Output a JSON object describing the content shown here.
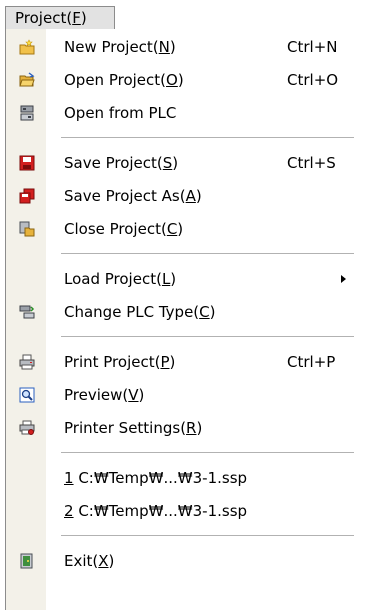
{
  "menu_title": {
    "pre": "Project(",
    "key": "F",
    "post": ")"
  },
  "items": [
    {
      "pre": "New Project(",
      "key": "N",
      "post": ")",
      "shortcut": "Ctrl+N",
      "icon": "new-project-icon"
    },
    {
      "pre": "Open Project(",
      "key": "O",
      "post": ")",
      "shortcut": "Ctrl+O",
      "icon": "open-project-icon"
    },
    {
      "pre": "Open from PLC",
      "key": "",
      "post": "",
      "shortcut": "",
      "icon": "open-from-plc-icon"
    },
    {
      "pre": "Save Project(",
      "key": "S",
      "post": ")",
      "shortcut": "Ctrl+S",
      "icon": "save-project-icon"
    },
    {
      "pre": "Save Project As(",
      "key": "A",
      "post": ")",
      "shortcut": "",
      "icon": "save-project-as-icon"
    },
    {
      "pre": "Close Project(",
      "key": "C",
      "post": ")",
      "shortcut": "",
      "icon": "close-project-icon"
    },
    {
      "pre": "Load Project(",
      "key": "L",
      "post": ")",
      "shortcut": "",
      "icon": "",
      "submenu": true
    },
    {
      "pre": "Change PLC Type(",
      "key": "C",
      "post": ")",
      "shortcut": "",
      "icon": "change-plc-type-icon"
    },
    {
      "pre": "Print Project(",
      "key": "P",
      "post": ")",
      "shortcut": "Ctrl+P",
      "icon": "printer-icon"
    },
    {
      "pre": "Preview(",
      "key": "V",
      "post": ")",
      "shortcut": "",
      "icon": "preview-icon"
    },
    {
      "pre": "Printer Settings(",
      "key": "R",
      "post": ")",
      "shortcut": "",
      "icon": "printer-settings-icon"
    },
    {
      "pre": "",
      "key": "1",
      "post": " C:₩Temp₩...₩3-1.ssp",
      "shortcut": "",
      "icon": ""
    },
    {
      "pre": "",
      "key": "2",
      "post": " C:₩Temp₩...₩3-1.ssp",
      "shortcut": "",
      "icon": ""
    },
    {
      "pre": "Exit(",
      "key": "X",
      "post": ")",
      "shortcut": "",
      "icon": "exit-icon"
    }
  ],
  "colors": {
    "gutter": "#f3f1e9",
    "separator": "#b2b2b2",
    "accent_red": "#d21f1f"
  }
}
